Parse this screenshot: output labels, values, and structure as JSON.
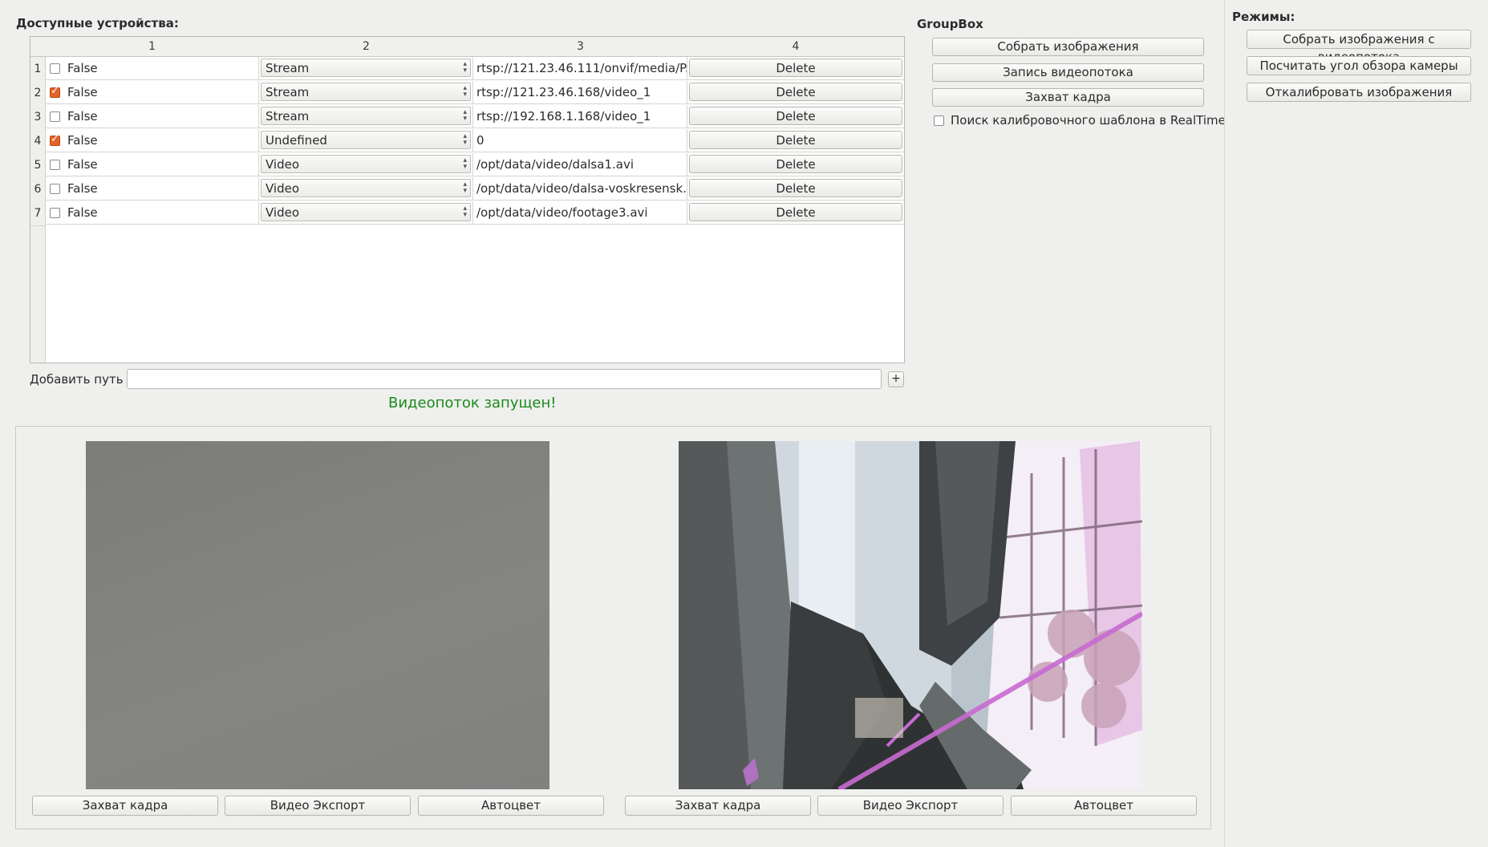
{
  "devices": {
    "title": "Доступные устройства:",
    "columns": [
      "1",
      "2",
      "3",
      "4"
    ],
    "rows": [
      {
        "num": "1",
        "checked": false,
        "flag": "False",
        "type": "Stream",
        "path": "rtsp://121.23.46.111/onvif/media/P...",
        "action": "Delete"
      },
      {
        "num": "2",
        "checked": true,
        "flag": "False",
        "type": "Stream",
        "path": "rtsp://121.23.46.168/video_1",
        "action": "Delete"
      },
      {
        "num": "3",
        "checked": false,
        "flag": "False",
        "type": "Stream",
        "path": "rtsp://192.168.1.168/video_1",
        "action": "Delete"
      },
      {
        "num": "4",
        "checked": true,
        "flag": "False",
        "type": "Undefined",
        "path": "0",
        "action": "Delete"
      },
      {
        "num": "5",
        "checked": false,
        "flag": "False",
        "type": "Video",
        "path": "/opt/data/video/dalsa1.avi",
        "action": "Delete"
      },
      {
        "num": "6",
        "checked": false,
        "flag": "False",
        "type": "Video",
        "path": "/opt/data/video/dalsa-voskresensk.avi",
        "action": "Delete"
      },
      {
        "num": "7",
        "checked": false,
        "flag": "False",
        "type": "Video",
        "path": "/opt/data/video/footage3.avi",
        "action": "Delete"
      }
    ]
  },
  "add_path": {
    "label": "Добавить путь :",
    "value": "",
    "add_button": "+"
  },
  "status": {
    "text": "Видеопоток запущен!",
    "color": "#1a8a1a"
  },
  "groupbox": {
    "title": "GroupBox",
    "buttons": [
      "Собрать изображения",
      "Запись видеопотока",
      "Захват кадра"
    ],
    "realtime_checkbox": {
      "label": "Поиск калибровочного шаблона в RealTime",
      "checked": false
    }
  },
  "modes": {
    "title": "Режимы:",
    "buttons": [
      "Собрать изображения с видеопотока",
      "Посчитать угол обзора камеры",
      "Откалибровать изображения"
    ]
  },
  "previews": {
    "left": {
      "buttons": [
        "Захват кадра",
        "Видео Экспорт",
        "Автоцвет"
      ]
    },
    "right": {
      "buttons": [
        "Захват кадра",
        "Видео Экспорт",
        "Автоцвет"
      ]
    }
  },
  "colors": {
    "accent": "#e3622a",
    "background": "#efefee"
  }
}
